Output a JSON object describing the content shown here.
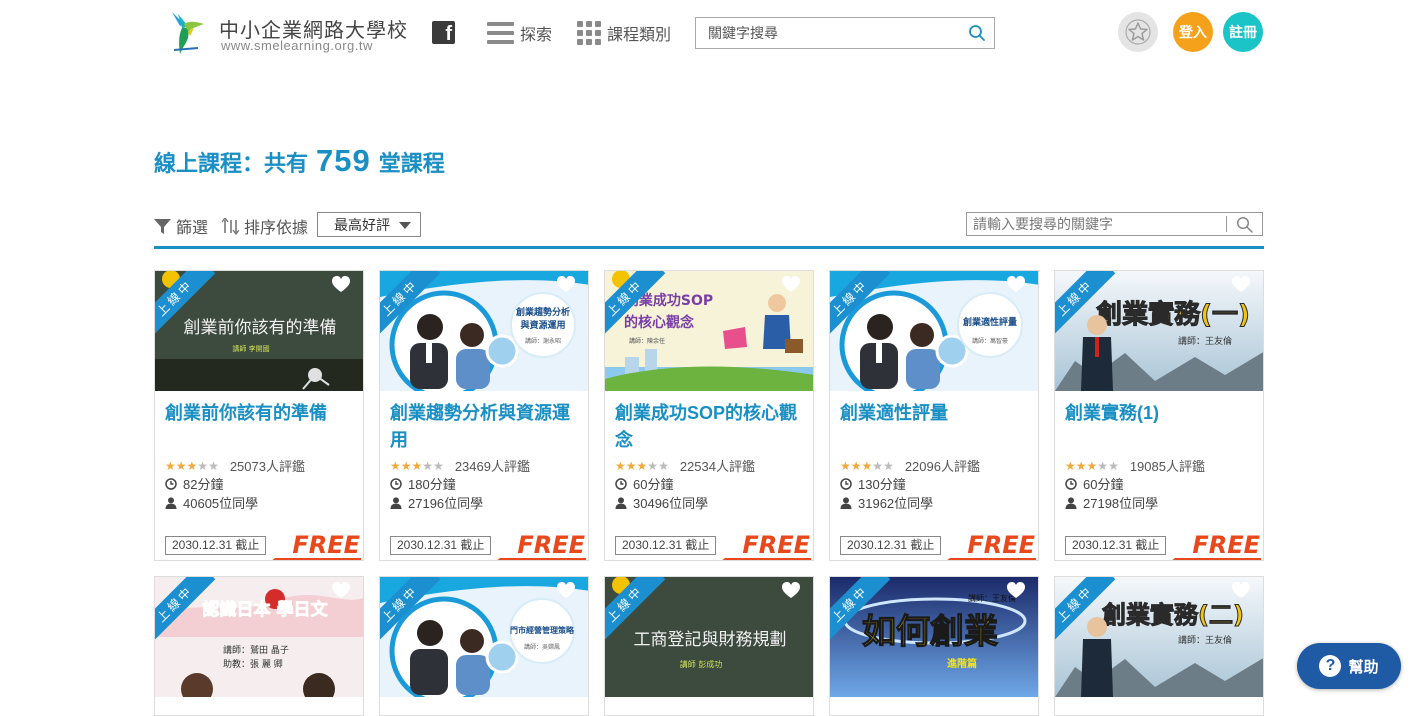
{
  "header": {
    "logo_title": "中小企業網路大學校",
    "logo_url": "www.smelearning.org.tw",
    "facebook_glyph": "f",
    "explore_label": "探索",
    "category_label": "課程類別",
    "search_placeholder": "關鍵字搜尋",
    "login_label": "登入",
    "register_label": "註冊"
  },
  "heading": {
    "prefix": "線上課程：共有",
    "count": "759",
    "suffix": "堂課程"
  },
  "toolbar": {
    "filter_label": "篩選",
    "sort_label": "排序依據",
    "sort_selected": "最高好評",
    "search_placeholder": "請輸入要搜尋的關鍵字"
  },
  "colors": {
    "accent": "#1a8fc4",
    "login": "#f5a11c",
    "register": "#1bc4c6",
    "ribbon": "#1c8fd0",
    "star": "#f2a93b",
    "free": "#e8481b",
    "help": "#1f5aa5"
  },
  "ribbon_label": "上線中",
  "free_label": "FREE",
  "courses": [
    {
      "title": "創業前你該有的準備",
      "thumb_title": "創業前你該有的準備",
      "thumb_sub": "講師 李開國",
      "stars": 3,
      "reviews": "25073人評鑑",
      "duration": "82分鐘",
      "students": "40605位同學",
      "deadline": "2030.12.31 截止"
    },
    {
      "title": "創業趨勢分析與資源運用",
      "thumb_title": "創業趨勢分析與資源運用",
      "thumb_sub": "講師：謝永昭",
      "stars": 3,
      "reviews": "23469人評鑑",
      "duration": "180分鐘",
      "students": "27196位同學",
      "deadline": "2030.12.31 截止"
    },
    {
      "title": "創業成功SOP的核心觀念",
      "thumb_title": "創業成功SOP的核心觀念",
      "thumb_sub": "講師：陳余任",
      "stars": 3,
      "reviews": "22534人評鑑",
      "duration": "60分鐘",
      "students": "30496位同學",
      "deadline": "2030.12.31 截止"
    },
    {
      "title": "創業適性評量",
      "thumb_title": "創業適性評量",
      "thumb_sub": "講師：萬智豪",
      "stars": 3,
      "reviews": "22096人評鑑",
      "duration": "130分鐘",
      "students": "31962位同學",
      "deadline": "2030.12.31 截止"
    },
    {
      "title": "創業實務(1)",
      "thumb_title": "創業實務(一)",
      "thumb_sub": "講師：王友倫",
      "stars": 3,
      "reviews": "19085人評鑑",
      "duration": "60分鐘",
      "students": "27198位同學",
      "deadline": "2030.12.31 截止"
    }
  ],
  "row2": [
    {
      "thumb_title": "認識日本 學日文",
      "thumb_sub": "講師：鷲田 晶子",
      "thumb_sub2": "助教：張 麗 卿"
    },
    {
      "thumb_title": "門市經營管理策略",
      "thumb_sub": "講師：吳嫦鳳"
    },
    {
      "thumb_title": "工商登記與財務規劃",
      "thumb_sub": "講師 彭成功"
    },
    {
      "thumb_title": "如何創業",
      "thumb_sub": "講師：王友倫",
      "thumb_sub2": "進階篇"
    },
    {
      "thumb_title": "創業實務(二)",
      "thumb_sub": "講師：王友倫"
    }
  ],
  "help_label": "幫助"
}
